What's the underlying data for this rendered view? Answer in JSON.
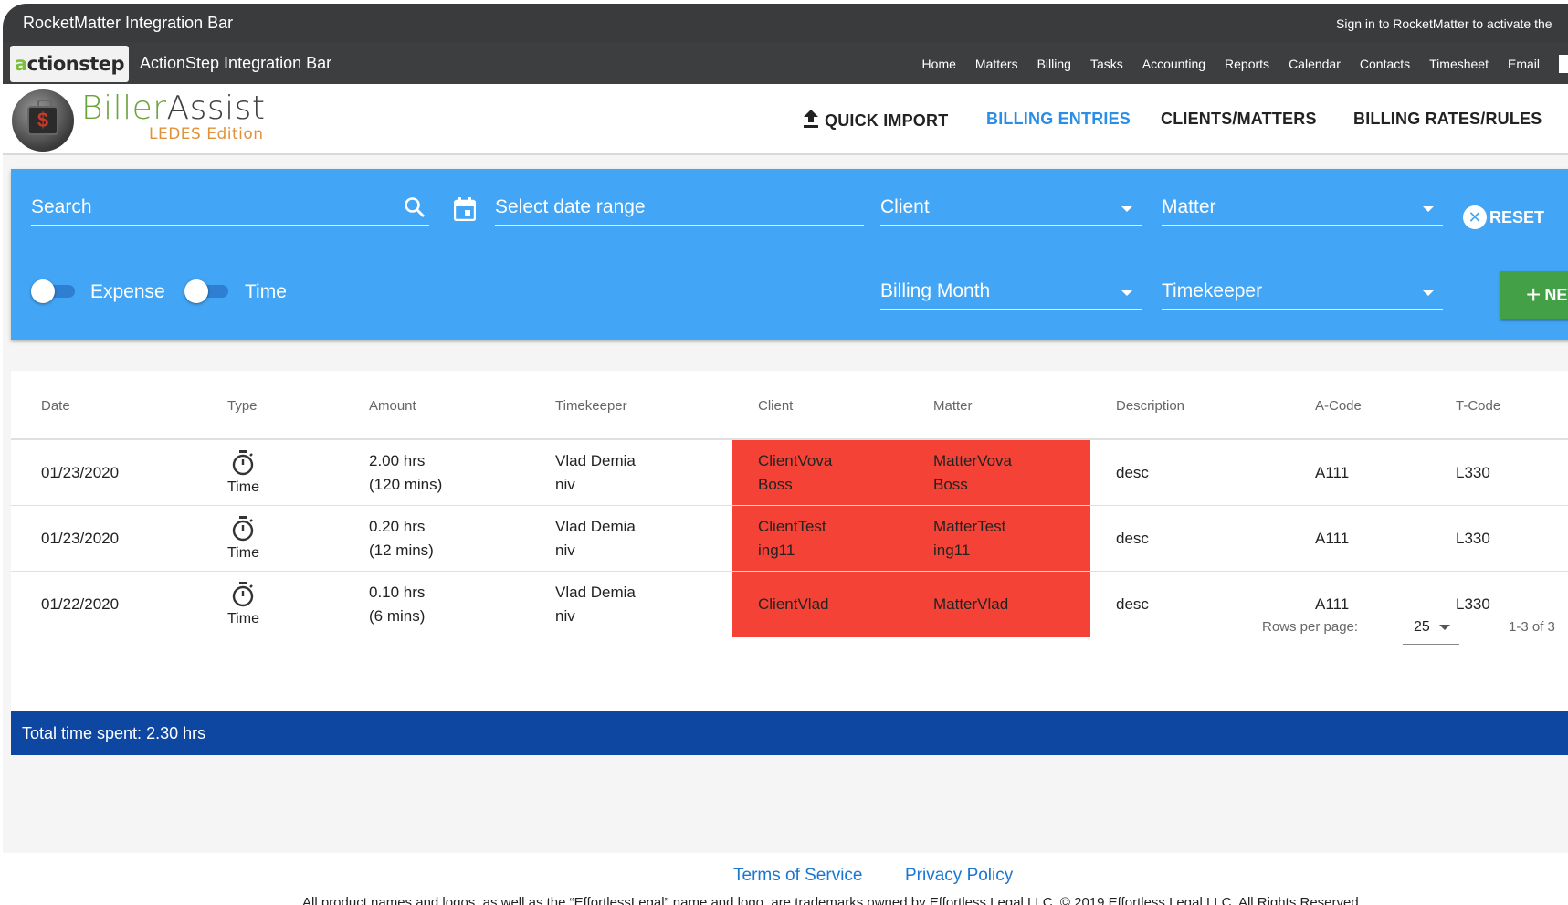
{
  "rocketmatter_bar": {
    "title": "RocketMatter Integration Bar",
    "signin": "Sign in to RocketMatter to activate the"
  },
  "actionstep_bar": {
    "logo": "actionstep",
    "title": "ActionStep Integration Bar",
    "nav": [
      "Home",
      "Matters",
      "Billing",
      "Tasks",
      "Accounting",
      "Reports",
      "Calendar",
      "Contacts",
      "Timesheet",
      "Email"
    ]
  },
  "app": {
    "brand_part1": "Biller",
    "brand_part2": "Assist",
    "brand_sub": "LEDES Edition",
    "nav": {
      "quick_import": "QUICK IMPORT",
      "billing_entries": "BILLING ENTRIES",
      "clients_matters": "CLIENTS/MATTERS",
      "billing_rates": "BILLING RATES/RULES"
    },
    "colors": {
      "accent": "#2a8ee6",
      "filter_bg": "#42a5f5",
      "new_button": "#43a047",
      "total_bar": "#0d47a1",
      "missing_cell": "#f44336"
    }
  },
  "filters": {
    "search": "Search",
    "date_range": "Select date range",
    "client": "Client",
    "matter": "Matter",
    "reset": "RESET",
    "expense": "Expense",
    "time": "Time",
    "billing_month": "Billing Month",
    "timekeeper": "Timekeeper",
    "new": "NEW"
  },
  "table": {
    "headers": [
      "Date",
      "Type",
      "Amount",
      "Timekeeper",
      "Client",
      "Matter",
      "Description",
      "A-Code",
      "T-Code"
    ],
    "rows": [
      {
        "date": "01/23/2020",
        "type": "Time",
        "amount1": "2.00 hrs",
        "amount2": "(120 mins)",
        "tk1": "Vlad Demia",
        "tk2": "niv",
        "client1": "ClientVova",
        "client2": "Boss",
        "matter1": "MatterVova",
        "matter2": "Boss",
        "desc": "desc",
        "acode": "A111",
        "tcode": "L330"
      },
      {
        "date": "01/23/2020",
        "type": "Time",
        "amount1": "0.20 hrs",
        "amount2": "(12 mins)",
        "tk1": "Vlad Demia",
        "tk2": "niv",
        "client1": "ClientTest",
        "client2": "ing11",
        "matter1": "MatterTest",
        "matter2": "ing11",
        "desc": "desc",
        "acode": "A111",
        "tcode": "L330"
      },
      {
        "date": "01/22/2020",
        "type": "Time",
        "amount1": "0.10 hrs",
        "amount2": "(6 mins)",
        "tk1": "Vlad Demia",
        "tk2": "niv",
        "client1": "ClientVlad",
        "client2": "",
        "matter1": "MatterVlad",
        "matter2": "",
        "desc": "desc",
        "acode": "A111",
        "tcode": "L330"
      }
    ],
    "rows_per_page_label": "Rows per page:",
    "rows_per_page": "25",
    "range": "1-3 of 3"
  },
  "total": "Total time spent: 2.30 hrs",
  "footer": {
    "terms": "Terms of Service",
    "privacy": "Privacy Policy",
    "legal": "All product names and logos, as well as the “EffortlessLegal” name and logo, are trademarks owned by Effortless Legal LLC. © 2019 Effortless Legal LLC. All Rights Reserved."
  }
}
